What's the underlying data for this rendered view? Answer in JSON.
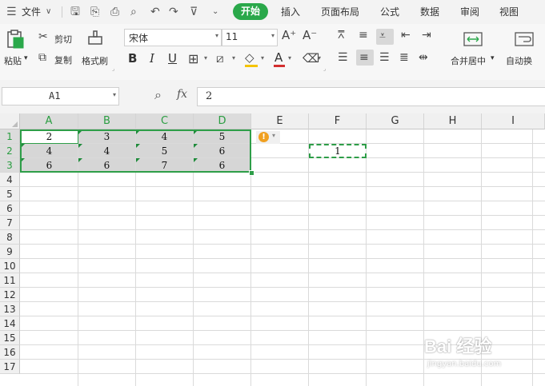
{
  "menu": {
    "hamburger_icon": "menu-icon",
    "file_label": "文件",
    "tabs": [
      "开始",
      "插入",
      "页面布局",
      "公式",
      "数据",
      "审阅",
      "视图"
    ],
    "active_tab_color": "#2aa84a"
  },
  "ribbon": {
    "paste_label": "粘贴",
    "cut_label": "剪切",
    "copy_label": "复制",
    "format_painter_label": "格式刷",
    "font_name": "宋体",
    "font_size": "11",
    "bold_label": "B",
    "italic_label": "I",
    "underline_label": "U",
    "merge_center_label": "合并居中",
    "auto_wrap_label": "自动换",
    "font_color": "#d32f2f",
    "fill_color": "#f5c400"
  },
  "formula_bar": {
    "name_box": "A1",
    "fx_label": "fx",
    "value": "2"
  },
  "sheet": {
    "columns": [
      "A",
      "B",
      "C",
      "D",
      "E",
      "F",
      "G",
      "H",
      "I"
    ],
    "rows": [
      "1",
      "2",
      "3",
      "4",
      "5",
      "6",
      "7",
      "8",
      "9",
      "10",
      "11",
      "12",
      "13",
      "14",
      "15",
      "16",
      "17"
    ],
    "cells": [
      [
        "2",
        "3",
        "4",
        "5"
      ],
      [
        "4",
        "4",
        "5",
        "6"
      ],
      [
        "6",
        "6",
        "7",
        "6"
      ]
    ],
    "f2_value": "1",
    "selection_color": "#2e9e48",
    "warning_icon": "warning-icon"
  },
  "watermark": {
    "line1": "Bai 经验",
    "line2": "jingyan.baidu.com"
  }
}
